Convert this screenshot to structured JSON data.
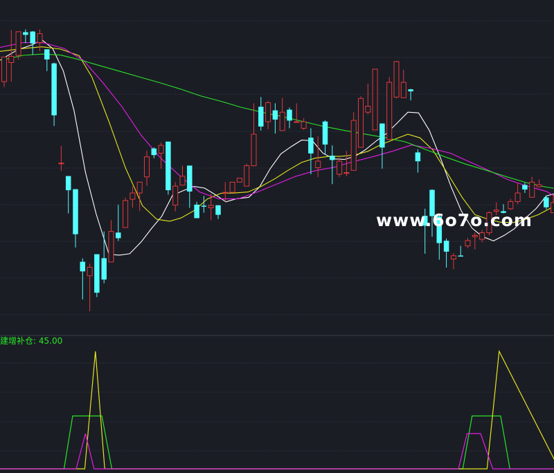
{
  "watermark": "www.6o7o.com",
  "indicator": {
    "name": "建增补仓:",
    "value": "45.00",
    "color": "#28e628"
  },
  "colors": {
    "background": "#1b1d25",
    "grid": "#2e313c",
    "separator": "#3a3d48",
    "up_candle": "#e03a3a",
    "down_candle": "#54ffff",
    "ma5": "#ffffff",
    "ma10": "#e6e61e",
    "ma20": "#e61ee6",
    "ma60": "#28e628"
  },
  "chart_data": [
    {
      "type": "candlestick",
      "title": "",
      "xlabel": "",
      "ylabel": "",
      "grid": true,
      "ylim": [
        0,
        100
      ],
      "candles": [
        [
          76.2,
          83.7,
          74.6,
          83.7
        ],
        [
          82.0,
          83.9,
          76.2,
          91.9
        ],
        [
          84.2,
          91.4,
          82.9,
          91.4
        ],
        [
          91.2,
          90.5,
          87.9,
          92.1
        ],
        [
          91.4,
          87.9,
          84.4,
          91.6
        ],
        [
          88.1,
          90.8,
          85.5,
          92.1
        ],
        [
          86.0,
          83.0,
          79.4,
          86.0
        ],
        [
          81.7,
          66.0,
          62.7,
          82.0
        ],
        [
          51.2,
          51.4,
          49.0,
          56.6
        ],
        [
          47.4,
          43.2,
          36.1,
          47.4
        ],
        [
          43.4,
          29.8,
          25.7,
          43.4
        ],
        [
          21.3,
          18.5,
          9.9,
          22.4
        ],
        [
          17.1,
          19.7,
          6.3,
          20.8
        ],
        [
          23.6,
          12.0,
          10.6,
          23.6
        ],
        [
          22.4,
          16.0,
          14.8,
          30.6
        ],
        [
          21.3,
          30.6,
          24.3,
          34.0
        ],
        [
          30.2,
          28.6,
          27.7,
          38.7
        ],
        [
          31.8,
          40.0,
          34.4,
          40.9
        ],
        [
          40.4,
          42.3,
          37.8,
          44.3
        ],
        [
          42.3,
          45.6,
          36.8,
          45.6
        ],
        [
          47.2,
          53.3,
          44.5,
          55.1
        ],
        [
          55.8,
          53.9,
          52.9,
          56.2
        ],
        [
          54.4,
          56.8,
          49.7,
          57.6
        ],
        [
          57.9,
          43.2,
          41.8,
          57.9
        ],
        [
          38.6,
          44.4,
          36.7,
          45.6
        ],
        [
          44.7,
          47.4,
          45.4,
          50.6
        ],
        [
          50.6,
          42.8,
          37.8,
          50.6
        ],
        [
          38.7,
          34.7,
          39.5,
          39.6
        ],
        [
          38.4,
          38.2,
          36.3,
          41.4
        ],
        [
          37.8,
          38.5,
          34.0,
          42.1
        ],
        [
          38.5,
          35.7,
          34.4,
          38.6
        ],
        [
          42.5,
          42.5,
          39.8,
          45.6
        ],
        [
          42.5,
          45.6,
          43.4,
          45.6
        ],
        [
          45.6,
          46.8,
          45.6,
          46.8
        ],
        [
          44.4,
          50.6,
          44.9,
          51.2
        ],
        [
          50.6,
          60.2,
          50.4,
          69.6
        ],
        [
          68.5,
          62.6,
          61.3,
          71.5
        ],
        [
          64.0,
          69.8,
          61.7,
          70.3
        ],
        [
          67.4,
          64.7,
          60.4,
          69.6
        ],
        [
          61.3,
          66.9,
          63.8,
          71.3
        ],
        [
          67.6,
          64.4,
          62.0,
          68.3
        ],
        [
          63.8,
          64.0,
          64.9,
          69.6
        ],
        [
          62.0,
          64.0,
          61.5,
          65.1
        ],
        [
          59.1,
          54.4,
          48.0,
          62.0
        ],
        [
          50.0,
          52.0,
          47.2,
          59.6
        ],
        [
          64.0,
          57.1,
          53.9,
          64.4
        ],
        [
          53.6,
          52.4,
          45.0,
          56.8
        ],
        [
          48.0,
          52.0,
          47.2,
          53.3
        ],
        [
          48.5,
          48.5,
          47.4,
          55.1
        ],
        [
          49.2,
          64.4,
          50.4,
          66.9
        ],
        [
          56.2,
          71.1,
          63.6,
          71.7
        ],
        [
          66.9,
          68.7,
          66.2,
          75.6
        ],
        [
          61.5,
          80.0,
          65.1,
          80.0
        ],
        [
          63.4,
          56.2,
          49.7,
          62.7
        ],
        [
          58.6,
          76.0,
          68.3,
          77.6
        ],
        [
          71.5,
          82.3,
          71.1,
          82.5
        ],
        [
          71.3,
          76.0,
          72.3,
          79.8
        ],
        [
          73.8,
          73.3,
          70.5,
          74.0
        ],
        [
          54.6,
          52.0,
          48.5,
          55.6
        ],
        [
          35.3,
          32.4,
          23.8,
          37.5
        ],
        [
          43.2,
          35.3,
          29.0,
          43.4
        ],
        [
          35.1,
          27.1,
          22.0,
          35.5
        ],
        [
          27.7,
          24.5,
          19.6,
          28.4
        ],
        [
          22.2,
          23.2,
          19.1,
          24.0
        ],
        [
          23.2,
          23.0,
          23.7,
          26.2
        ],
        [
          26.2,
          27.8,
          25.5,
          28.6
        ],
        [
          29.0,
          29.4,
          25.1,
          30.2
        ],
        [
          28.2,
          30.2,
          27.3,
          31.0
        ],
        [
          30.2,
          36.3,
          29.4,
          36.7
        ],
        [
          36.7,
          37.1,
          35.5,
          39.5
        ],
        [
          36.7,
          36.3,
          36.1,
          38.9
        ],
        [
          37.5,
          39.7,
          37.1,
          40.5
        ],
        [
          39.7,
          42.3,
          38.9,
          45.2
        ],
        [
          44.7,
          43.4,
          42.3,
          45.4
        ],
        [
          41.0,
          45.6,
          42.1,
          47.2
        ],
        [
          44.2,
          44.8,
          44.0,
          46.4
        ],
        [
          40.9,
          38.0,
          37.3,
          41.6
        ],
        [
          36.3,
          39.4,
          36.7,
          41.6
        ]
      ],
      "moving_averages": [
        {
          "name": "",
          "color": "#ffffff",
          "points": [
            [
              -0.6,
              82.7
            ],
            [
              1.8,
              85.8
            ],
            [
              3.8,
              87.3
            ],
            [
              5.3,
              88.9
            ],
            [
              6.8,
              86.3
            ],
            [
              8.3,
              79.4
            ],
            [
              9.8,
              67.4
            ],
            [
              11.4,
              48.6
            ],
            [
              12.9,
              35.9
            ],
            [
              14.7,
              23.6
            ],
            [
              16.2,
              23.4
            ],
            [
              17.6,
              23.8
            ],
            [
              19.2,
              27.4
            ],
            [
              20.7,
              31.6
            ],
            [
              22.1,
              35.2
            ],
            [
              23.6,
              41.6
            ],
            [
              25.1,
              43.0
            ],
            [
              26.6,
              44.3
            ],
            [
              28.1,
              43.8
            ],
            [
              29.6,
              41.8
            ],
            [
              31.1,
              39.6
            ],
            [
              32.5,
              40.5
            ],
            [
              34.3,
              41.0
            ],
            [
              35.8,
              44.1
            ],
            [
              37.3,
              49.7
            ],
            [
              38.8,
              54.2
            ],
            [
              40.3,
              56.5
            ],
            [
              41.7,
              58.4
            ],
            [
              43.2,
              58.2
            ],
            [
              44.7,
              54.4
            ],
            [
              46.2,
              52.7
            ],
            [
              47.7,
              52.5
            ],
            [
              49.2,
              53.5
            ],
            [
              50.6,
              55.4
            ],
            [
              52.2,
              58.2
            ],
            [
              53.6,
              60.4
            ],
            [
              55.1,
              63.6
            ],
            [
              56.6,
              66.9
            ],
            [
              58.1,
              66.7
            ],
            [
              59.6,
              61.4
            ],
            [
              61.2,
              52.8
            ],
            [
              62.6,
              44.5
            ],
            [
              64.1,
              36.8
            ],
            [
              65.6,
              31.6
            ],
            [
              67.0,
              29.1
            ],
            [
              68.6,
              27.7
            ],
            [
              70.1,
              29.4
            ],
            [
              71.5,
              31.4
            ],
            [
              73.1,
              34.7
            ],
            [
              74.6,
              37.6
            ],
            [
              76.0,
              41.4
            ],
            [
              77.6,
              42.3
            ]
          ]
        },
        {
          "name": "",
          "color": "#e6e61e",
          "points": [
            [
              -0.6,
              85.4
            ],
            [
              2.7,
              86.3
            ],
            [
              5.3,
              86.8
            ],
            [
              7.9,
              86.1
            ],
            [
              10.5,
              84.1
            ],
            [
              12.3,
              77.6
            ],
            [
              14.7,
              64.0
            ],
            [
              17.0,
              50.0
            ],
            [
              19.4,
              38.4
            ],
            [
              21.4,
              34.3
            ],
            [
              23.2,
              33.7
            ],
            [
              24.8,
              34.7
            ],
            [
              26.6,
              36.9
            ],
            [
              28.5,
              40.5
            ],
            [
              30.4,
              42.2
            ],
            [
              32.3,
              42.3
            ],
            [
              34.2,
              42.6
            ],
            [
              36.1,
              44.4
            ],
            [
              38.0,
              46.7
            ],
            [
              39.8,
              49.2
            ],
            [
              41.7,
              51.6
            ],
            [
              43.6,
              52.9
            ],
            [
              45.4,
              53.4
            ],
            [
              47.3,
              53.5
            ],
            [
              49.2,
              53.9
            ],
            [
              51.0,
              55.0
            ],
            [
              52.9,
              57.1
            ],
            [
              54.9,
              58.8
            ],
            [
              56.6,
              60.2
            ],
            [
              58.3,
              59.1
            ],
            [
              60.1,
              55.4
            ],
            [
              62.2,
              48.1
            ],
            [
              64.2,
              41.0
            ],
            [
              66.0,
              35.7
            ],
            [
              67.7,
              34.4
            ],
            [
              69.6,
              33.4
            ],
            [
              71.4,
              33.3
            ],
            [
              73.1,
              34.3
            ],
            [
              74.9,
              35.7
            ],
            [
              76.7,
              37.8
            ],
            [
              77.8,
              38.9
            ]
          ]
        },
        {
          "name": "",
          "color": "#e61ee6",
          "points": [
            [
              -0.6,
              86.6
            ],
            [
              2.7,
              88.1
            ],
            [
              5.6,
              88.0
            ],
            [
              8.4,
              86.3
            ],
            [
              11.1,
              82.7
            ],
            [
              13.8,
              76.0
            ],
            [
              16.5,
              68.6
            ],
            [
              19.2,
              59.9
            ],
            [
              22.0,
              52.8
            ],
            [
              24.7,
              47.4
            ],
            [
              27.4,
              42.6
            ],
            [
              30.1,
              40.5
            ],
            [
              32.8,
              40.5
            ],
            [
              35.5,
              42.6
            ],
            [
              38.2,
              45.0
            ],
            [
              40.9,
              47.4
            ],
            [
              43.6,
              49.1
            ],
            [
              46.2,
              50.1
            ],
            [
              48.9,
              51.8
            ],
            [
              51.6,
              53.3
            ],
            [
              54.4,
              55.0
            ],
            [
              57.1,
              56.9
            ],
            [
              59.8,
              55.9
            ],
            [
              62.6,
              54.4
            ],
            [
              65.2,
              51.8
            ],
            [
              67.9,
              49.2
            ],
            [
              70.6,
              46.4
            ],
            [
              73.3,
              44.4
            ],
            [
              76.0,
              42.8
            ],
            [
              77.8,
              40.6
            ]
          ]
        },
        {
          "name": "",
          "color": "#28e628",
          "points": [
            [
              -0.6,
              82.7
            ],
            [
              2.7,
              84.2
            ],
            [
              5.3,
              84.6
            ],
            [
              7.9,
              84.3
            ],
            [
              10.5,
              82.9
            ],
            [
              13.2,
              81.2
            ],
            [
              16.1,
              79.4
            ],
            [
              19.0,
              77.6
            ],
            [
              21.9,
              75.8
            ],
            [
              24.8,
              73.9
            ],
            [
              27.6,
              71.8
            ],
            [
              30.4,
              70.2
            ],
            [
              33.2,
              68.4
            ],
            [
              36.1,
              66.9
            ],
            [
              38.9,
              65.6
            ],
            [
              41.8,
              64.1
            ],
            [
              44.7,
              62.6
            ],
            [
              47.6,
              61.4
            ],
            [
              50.4,
              60.3
            ],
            [
              53.3,
              59.2
            ],
            [
              56.2,
              57.9
            ],
            [
              59.0,
              55.6
            ],
            [
              61.8,
              53.3
            ],
            [
              64.7,
              51.1
            ],
            [
              67.6,
              49.2
            ],
            [
              70.5,
              47.2
            ],
            [
              73.3,
              45.4
            ],
            [
              76.0,
              44.1
            ],
            [
              77.8,
              43.5
            ]
          ]
        }
      ]
    },
    {
      "type": "line",
      "title": "建增补仓:",
      "grid": true,
      "ylim": [
        0,
        100
      ],
      "series": [
        {
          "name": "",
          "color": "#28e628",
          "x": [
            -0.6,
            8.4,
            9.6,
            13.7,
            15.1,
            64.3,
            65.6,
            69.6,
            70.9,
            77.8
          ],
          "values": [
            0,
            0,
            45,
            45,
            0,
            0,
            45,
            45,
            0,
            0
          ]
        },
        {
          "name": "",
          "color": "#e6e61e",
          "x": [
            -0.6,
            11.3,
            12.8,
            14.1,
            64.4,
            67.7,
            69.4,
            77.8
          ],
          "values": [
            0,
            0,
            100,
            0,
            0,
            0,
            100,
            0
          ]
        },
        {
          "name": "",
          "color": "#e61ee6",
          "x": [
            -0.6,
            10.1,
            11.4,
            12.6,
            63.7,
            64.9,
            66.8,
            68.5,
            77.8
          ],
          "values": [
            0,
            0,
            30,
            0,
            0,
            30,
            30,
            0,
            0
          ]
        }
      ]
    }
  ]
}
